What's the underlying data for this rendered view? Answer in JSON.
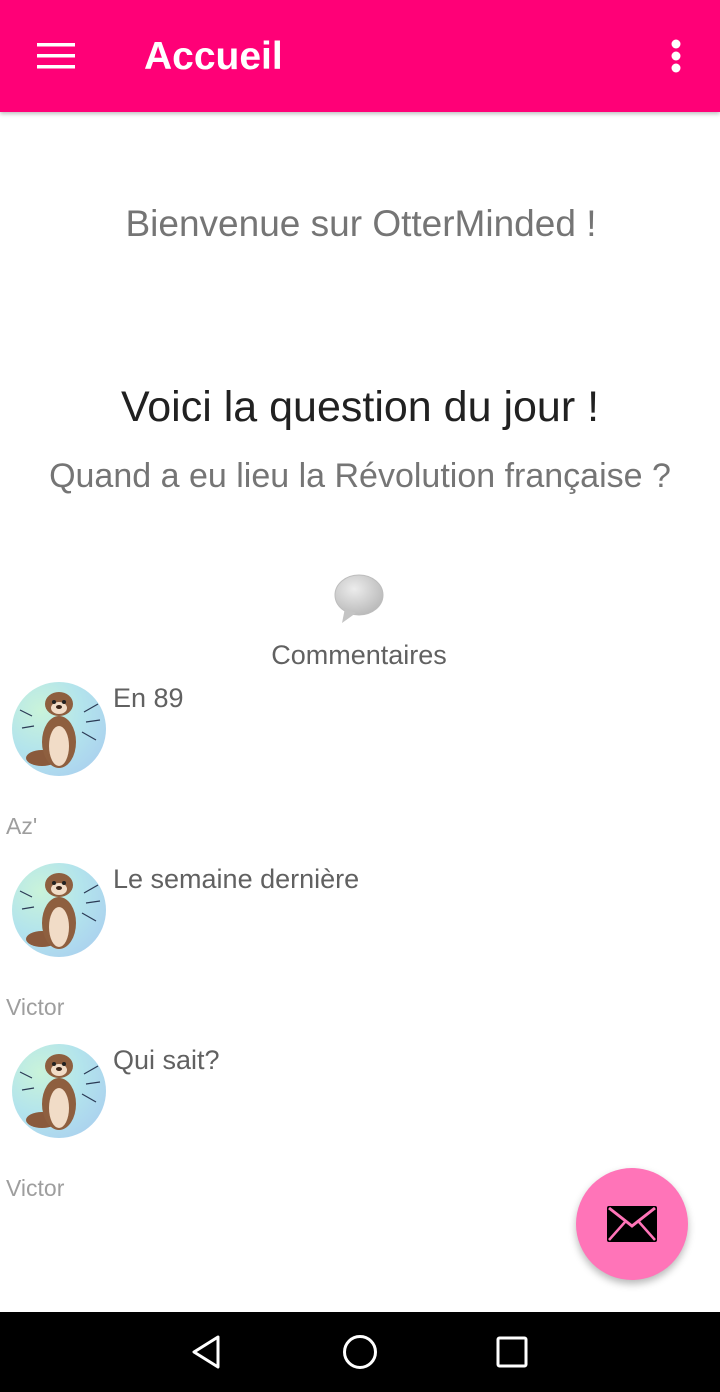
{
  "appbar": {
    "title": "Accueil",
    "menu_icon": "hamburger-menu-icon",
    "overflow_icon": "more-vert-icon",
    "color": "#ff0077"
  },
  "main": {
    "welcome": "Bienvenue sur OtterMinded !",
    "question_heading": "Voici la question du jour !",
    "question_text": "Quand a eu lieu la Révolution française ?",
    "comments_icon": "speech-bubble-icon",
    "comments_label": "Commentaires"
  },
  "comments": [
    {
      "text": "En 89",
      "author": "Az'",
      "avatar": "otter-avatar"
    },
    {
      "text": "Le semaine dernière",
      "author": "Victor",
      "avatar": "otter-avatar"
    },
    {
      "text": "Qui sait?",
      "author": "Victor",
      "avatar": "otter-avatar"
    }
  ],
  "fab": {
    "icon": "envelope-icon",
    "color": "#ff74b8"
  },
  "system_nav": {
    "back_icon": "back-triangle-icon",
    "home_icon": "home-circle-icon",
    "recents_icon": "recents-square-icon"
  }
}
